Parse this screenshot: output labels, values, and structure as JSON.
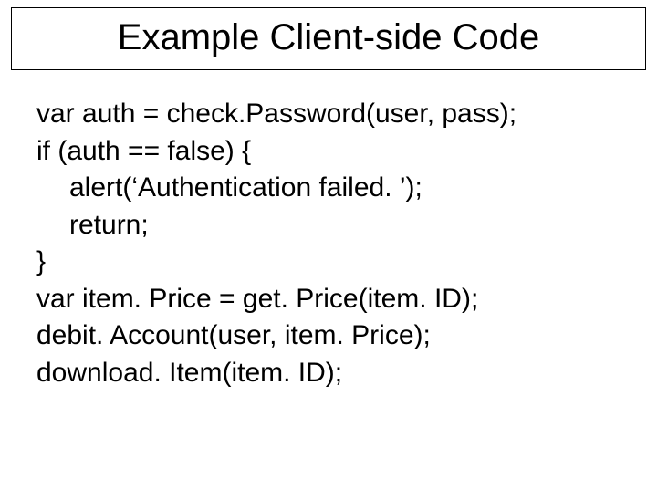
{
  "title": "Example Client-side Code",
  "code": {
    "line1": "var auth = check.Password(user, pass);",
    "line2": "if (auth == false) {",
    "line3": "alert(‘Authentication failed. ’);",
    "line4": "return;",
    "line5": "}",
    "line6": "var item. Price = get. Price(item. ID);",
    "line7": "debit. Account(user, item. Price);",
    "line8": "download. Item(item. ID);"
  }
}
